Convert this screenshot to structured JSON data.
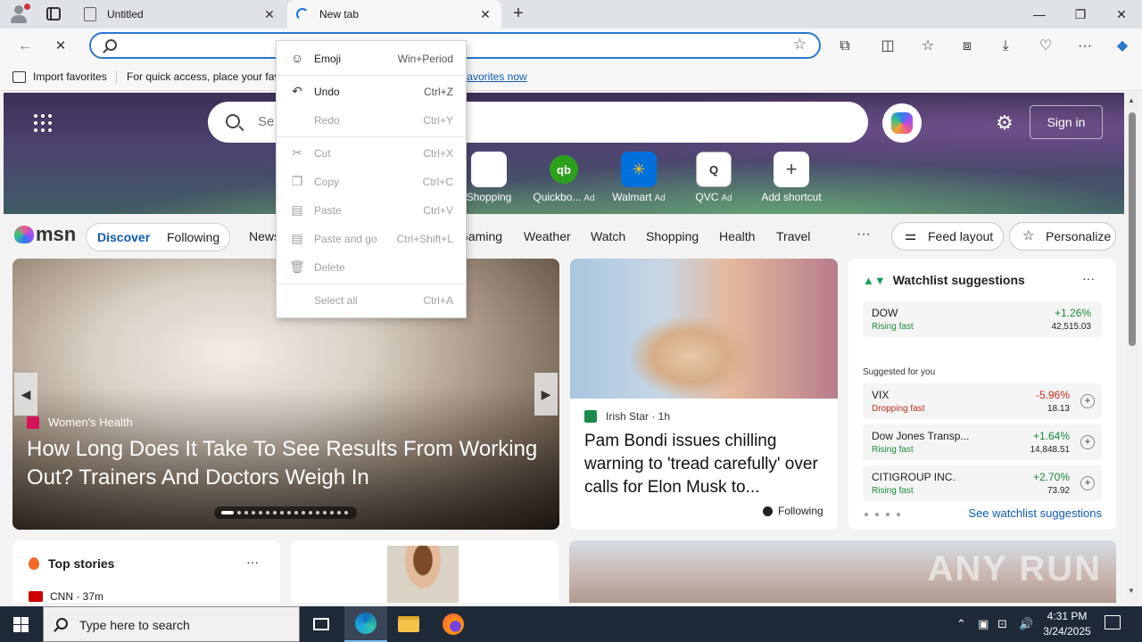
{
  "browser": {
    "tabs": [
      {
        "title": "Untitled",
        "close": "✕"
      },
      {
        "title": "New tab",
        "close": "✕"
      }
    ],
    "new_tab": "+",
    "window": {
      "minimize": "—",
      "maximize": "❐",
      "close": "✕"
    },
    "omnibox": {
      "value": "",
      "placeholder": ""
    },
    "favorites_bar": {
      "import": "Import favorites",
      "message": "For quick access, place your fav",
      "link": "favorites now"
    }
  },
  "msn": {
    "search_placeholder": "Se",
    "sign_in": "Sign in",
    "shortcuts": [
      {
        "label": "Shopping",
        "ad": "",
        "glyph": "🏷"
      },
      {
        "label": "Quickbo...",
        "ad": "Ad",
        "glyph": "qb"
      },
      {
        "label": "Walmart",
        "ad": "Ad",
        "glyph": "✳"
      },
      {
        "label": "QVC",
        "ad": "Ad",
        "glyph": "Q"
      },
      {
        "label": "Add shortcut",
        "ad": "",
        "glyph": "+"
      }
    ],
    "logo": "msn",
    "nav": {
      "discover": "Discover",
      "following": "Following",
      "links": [
        "News",
        "Gaming",
        "Weather",
        "Watch",
        "Shopping",
        "Health",
        "Travel"
      ],
      "more": "···",
      "feed_layout": "Feed layout",
      "personalize": "Personalize"
    },
    "hero_story": {
      "source": "Women's Health",
      "headline": "How Long Does It Take To See Results From Working Out? Trainers And Doctors Weigh In"
    },
    "card2": {
      "source": "Irish Star · 1h",
      "title": "Pam Bondi issues chilling warning to 'tread carefully' over calls for Elon Musk to...",
      "following": "Following"
    },
    "watchlist": {
      "title": "Watchlist suggestions",
      "more": "···",
      "suggested_label": "Suggested for you",
      "see_all": "See watchlist suggestions",
      "items": [
        {
          "name": "DOW",
          "status": "Rising fast",
          "change": "+1.26%",
          "price": "42,515.03",
          "trend": "up"
        },
        {
          "name": "VIX",
          "status": "Dropping fast",
          "change": "-5.96%",
          "price": "18.13",
          "trend": "down"
        },
        {
          "name": "Dow Jones Transp...",
          "status": "Rising fast",
          "change": "+1.64%",
          "price": "14,848.51",
          "trend": "up"
        },
        {
          "name": "CITIGROUP INC.",
          "status": "Rising fast",
          "change": "+2.70%",
          "price": "73.92",
          "trend": "up"
        }
      ]
    },
    "top_stories": {
      "title": "Top stories",
      "more": "···",
      "source": "CNN · 37m"
    }
  },
  "context_menu": {
    "items": [
      {
        "label": "Emoji",
        "shortcut": "Win+Period",
        "enabled": true
      },
      {
        "label": "Undo",
        "shortcut": "Ctrl+Z",
        "enabled": true
      },
      {
        "label": "Redo",
        "shortcut": "Ctrl+Y",
        "enabled": false
      },
      {
        "label": "Cut",
        "shortcut": "Ctrl+X",
        "enabled": false
      },
      {
        "label": "Copy",
        "shortcut": "Ctrl+C",
        "enabled": false
      },
      {
        "label": "Paste",
        "shortcut": "Ctrl+V",
        "enabled": false
      },
      {
        "label": "Paste and go",
        "shortcut": "Ctrl+Shift+L",
        "enabled": false
      },
      {
        "label": "Delete",
        "shortcut": "",
        "enabled": false
      },
      {
        "label": "Select all",
        "shortcut": "Ctrl+A",
        "enabled": false
      }
    ]
  },
  "taskbar": {
    "search_placeholder": "Type here to search",
    "time": "4:31 PM",
    "date": "3/24/2025"
  },
  "watermark": "ANY RUN",
  "colors": {
    "accent": "#0f5bb5",
    "rise": "#1b8a3a",
    "drop": "#c42b1c",
    "taskbar": "#1f2a38"
  }
}
